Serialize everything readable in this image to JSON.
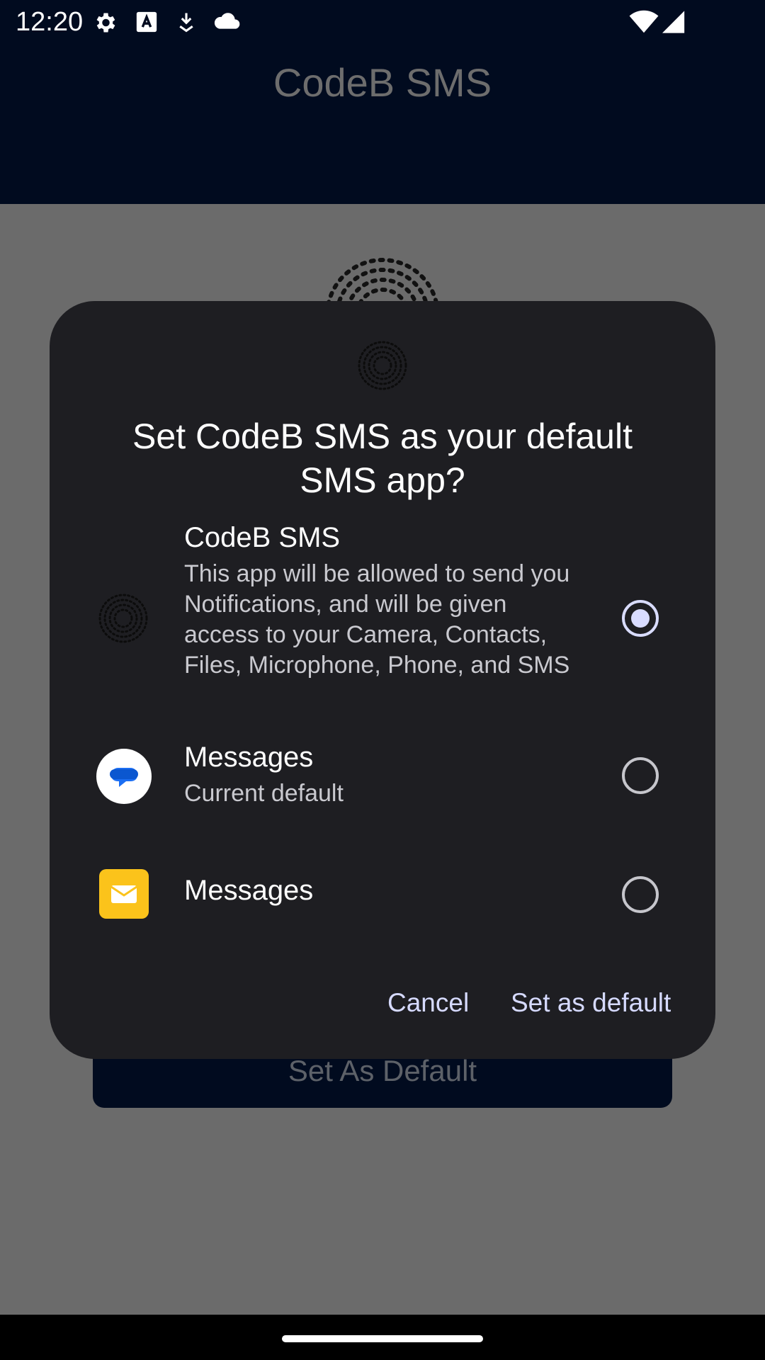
{
  "status_bar": {
    "time": "12:20",
    "left_icons": [
      "gear-icon",
      "font-a-icon",
      "download-icon",
      "cloud-icon"
    ],
    "right_icons": [
      "wifi-icon",
      "signal-icon"
    ]
  },
  "app": {
    "title": "CodeB SMS",
    "set_default_button": "Set As Default",
    "colors": {
      "app_bar": "#010b1f",
      "scrim": "#6b6b6b"
    }
  },
  "dialog": {
    "title": "Set CodeB SMS as your default SMS app?",
    "options": [
      {
        "name": "CodeB SMS",
        "description": "This app will be allowed to send you Notifications, and will be given access to your Camera, Contacts, Files, Microphone, Phone, and SMS",
        "icon": "codeb-logo-icon",
        "selected": true
      },
      {
        "name": "Messages",
        "description": "Current default",
        "icon": "google-messages-icon",
        "selected": false
      },
      {
        "name": "Messages",
        "description": "",
        "icon": "envelope-icon",
        "selected": false
      }
    ],
    "cancel_label": "Cancel",
    "confirm_label": "Set as default",
    "colors": {
      "surface": "#1e1e22",
      "accent": "#d6daff"
    }
  }
}
